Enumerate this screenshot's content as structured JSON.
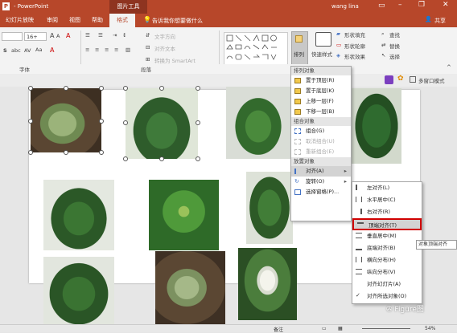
{
  "titlebar": {
    "title": "- PowerPoint",
    "context_tab": "图片工具",
    "user": "wang lina"
  },
  "tabs": [
    "幻灯片放映",
    "审阅",
    "视图",
    "帮助",
    "格式"
  ],
  "tellme": "告诉我你想要做什么",
  "share": "共享",
  "ribbon": {
    "font_size": "16+",
    "text_direction": "文字方向",
    "align_text": "对齐文本",
    "smartart": "转换为 SmartArt",
    "arrange": "排列",
    "quick_styles": "快速样式",
    "fill": "形状填充",
    "outline": "形状轮廓",
    "effects": "形状效果",
    "find": "查找",
    "replace": "替换",
    "select": "选择",
    "group_font": "字体",
    "group_paragraph": "段落",
    "multi_window": "多窗口模式"
  },
  "arrange_menu": {
    "header1": "排列对象",
    "items1": [
      {
        "label": "置于顶层(R)",
        "disabled": false
      },
      {
        "label": "置于底层(K)",
        "disabled": false
      },
      {
        "label": "上移一层(F)",
        "disabled": false
      },
      {
        "label": "下移一层(B)",
        "disabled": false
      }
    ],
    "header2": "组合对象",
    "items2": [
      {
        "label": "组合(G)",
        "disabled": false
      },
      {
        "label": "取消组合(U)",
        "disabled": true
      },
      {
        "label": "重新组合(E)",
        "disabled": true
      }
    ],
    "header3": "放置对象",
    "items3": [
      {
        "label": "对齐(A)",
        "disabled": false
      },
      {
        "label": "旋转(O)",
        "disabled": false
      },
      {
        "label": "选择窗格(P)...",
        "disabled": false
      }
    ]
  },
  "align_menu": [
    "左对齐(L)",
    "水平居中(C)",
    "右对齐(R)",
    "顶端对齐(T)",
    "垂直居中(M)",
    "底端对齐(B)",
    "横向分布(H)",
    "纵向分布(V)",
    "对齐幻灯片(A)",
    "对齐所选对象(O)"
  ],
  "tooltip": "对象顶端对齐",
  "statusbar": {
    "notes": "备注",
    "zoom": "54%"
  },
  "watermark": "Figure图"
}
